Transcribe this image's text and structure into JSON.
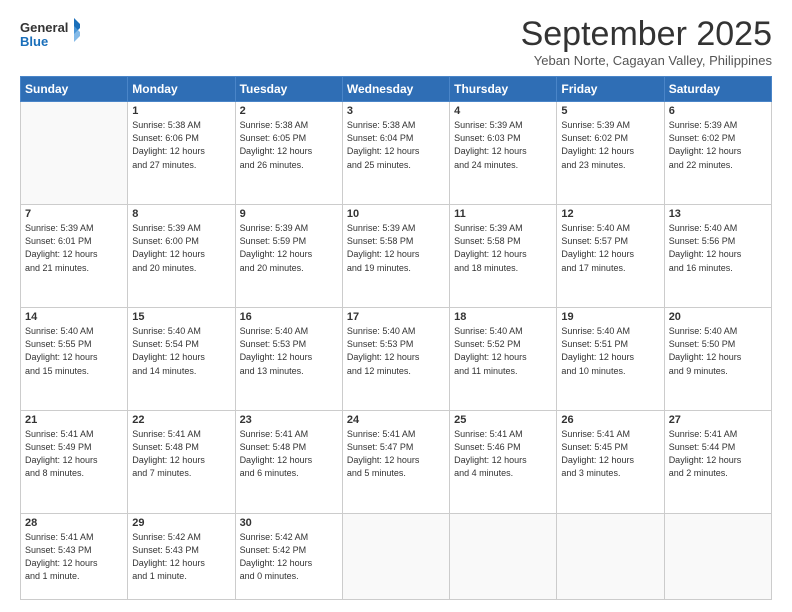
{
  "logo": {
    "line1": "General",
    "line2": "Blue"
  },
  "title": "September 2025",
  "subtitle": "Yeban Norte, Cagayan Valley, Philippines",
  "weekdays": [
    "Sunday",
    "Monday",
    "Tuesday",
    "Wednesday",
    "Thursday",
    "Friday",
    "Saturday"
  ],
  "weeks": [
    [
      {
        "day": "",
        "info": ""
      },
      {
        "day": "1",
        "info": "Sunrise: 5:38 AM\nSunset: 6:06 PM\nDaylight: 12 hours\nand 27 minutes."
      },
      {
        "day": "2",
        "info": "Sunrise: 5:38 AM\nSunset: 6:05 PM\nDaylight: 12 hours\nand 26 minutes."
      },
      {
        "day": "3",
        "info": "Sunrise: 5:38 AM\nSunset: 6:04 PM\nDaylight: 12 hours\nand 25 minutes."
      },
      {
        "day": "4",
        "info": "Sunrise: 5:39 AM\nSunset: 6:03 PM\nDaylight: 12 hours\nand 24 minutes."
      },
      {
        "day": "5",
        "info": "Sunrise: 5:39 AM\nSunset: 6:02 PM\nDaylight: 12 hours\nand 23 minutes."
      },
      {
        "day": "6",
        "info": "Sunrise: 5:39 AM\nSunset: 6:02 PM\nDaylight: 12 hours\nand 22 minutes."
      }
    ],
    [
      {
        "day": "7",
        "info": "Sunrise: 5:39 AM\nSunset: 6:01 PM\nDaylight: 12 hours\nand 21 minutes."
      },
      {
        "day": "8",
        "info": "Sunrise: 5:39 AM\nSunset: 6:00 PM\nDaylight: 12 hours\nand 20 minutes."
      },
      {
        "day": "9",
        "info": "Sunrise: 5:39 AM\nSunset: 5:59 PM\nDaylight: 12 hours\nand 20 minutes."
      },
      {
        "day": "10",
        "info": "Sunrise: 5:39 AM\nSunset: 5:58 PM\nDaylight: 12 hours\nand 19 minutes."
      },
      {
        "day": "11",
        "info": "Sunrise: 5:39 AM\nSunset: 5:58 PM\nDaylight: 12 hours\nand 18 minutes."
      },
      {
        "day": "12",
        "info": "Sunrise: 5:40 AM\nSunset: 5:57 PM\nDaylight: 12 hours\nand 17 minutes."
      },
      {
        "day": "13",
        "info": "Sunrise: 5:40 AM\nSunset: 5:56 PM\nDaylight: 12 hours\nand 16 minutes."
      }
    ],
    [
      {
        "day": "14",
        "info": "Sunrise: 5:40 AM\nSunset: 5:55 PM\nDaylight: 12 hours\nand 15 minutes."
      },
      {
        "day": "15",
        "info": "Sunrise: 5:40 AM\nSunset: 5:54 PM\nDaylight: 12 hours\nand 14 minutes."
      },
      {
        "day": "16",
        "info": "Sunrise: 5:40 AM\nSunset: 5:53 PM\nDaylight: 12 hours\nand 13 minutes."
      },
      {
        "day": "17",
        "info": "Sunrise: 5:40 AM\nSunset: 5:53 PM\nDaylight: 12 hours\nand 12 minutes."
      },
      {
        "day": "18",
        "info": "Sunrise: 5:40 AM\nSunset: 5:52 PM\nDaylight: 12 hours\nand 11 minutes."
      },
      {
        "day": "19",
        "info": "Sunrise: 5:40 AM\nSunset: 5:51 PM\nDaylight: 12 hours\nand 10 minutes."
      },
      {
        "day": "20",
        "info": "Sunrise: 5:40 AM\nSunset: 5:50 PM\nDaylight: 12 hours\nand 9 minutes."
      }
    ],
    [
      {
        "day": "21",
        "info": "Sunrise: 5:41 AM\nSunset: 5:49 PM\nDaylight: 12 hours\nand 8 minutes."
      },
      {
        "day": "22",
        "info": "Sunrise: 5:41 AM\nSunset: 5:48 PM\nDaylight: 12 hours\nand 7 minutes."
      },
      {
        "day": "23",
        "info": "Sunrise: 5:41 AM\nSunset: 5:48 PM\nDaylight: 12 hours\nand 6 minutes."
      },
      {
        "day": "24",
        "info": "Sunrise: 5:41 AM\nSunset: 5:47 PM\nDaylight: 12 hours\nand 5 minutes."
      },
      {
        "day": "25",
        "info": "Sunrise: 5:41 AM\nSunset: 5:46 PM\nDaylight: 12 hours\nand 4 minutes."
      },
      {
        "day": "26",
        "info": "Sunrise: 5:41 AM\nSunset: 5:45 PM\nDaylight: 12 hours\nand 3 minutes."
      },
      {
        "day": "27",
        "info": "Sunrise: 5:41 AM\nSunset: 5:44 PM\nDaylight: 12 hours\nand 2 minutes."
      }
    ],
    [
      {
        "day": "28",
        "info": "Sunrise: 5:41 AM\nSunset: 5:43 PM\nDaylight: 12 hours\nand 1 minute."
      },
      {
        "day": "29",
        "info": "Sunrise: 5:42 AM\nSunset: 5:43 PM\nDaylight: 12 hours\nand 1 minute."
      },
      {
        "day": "30",
        "info": "Sunrise: 5:42 AM\nSunset: 5:42 PM\nDaylight: 12 hours\nand 0 minutes."
      },
      {
        "day": "",
        "info": ""
      },
      {
        "day": "",
        "info": ""
      },
      {
        "day": "",
        "info": ""
      },
      {
        "day": "",
        "info": ""
      }
    ]
  ]
}
